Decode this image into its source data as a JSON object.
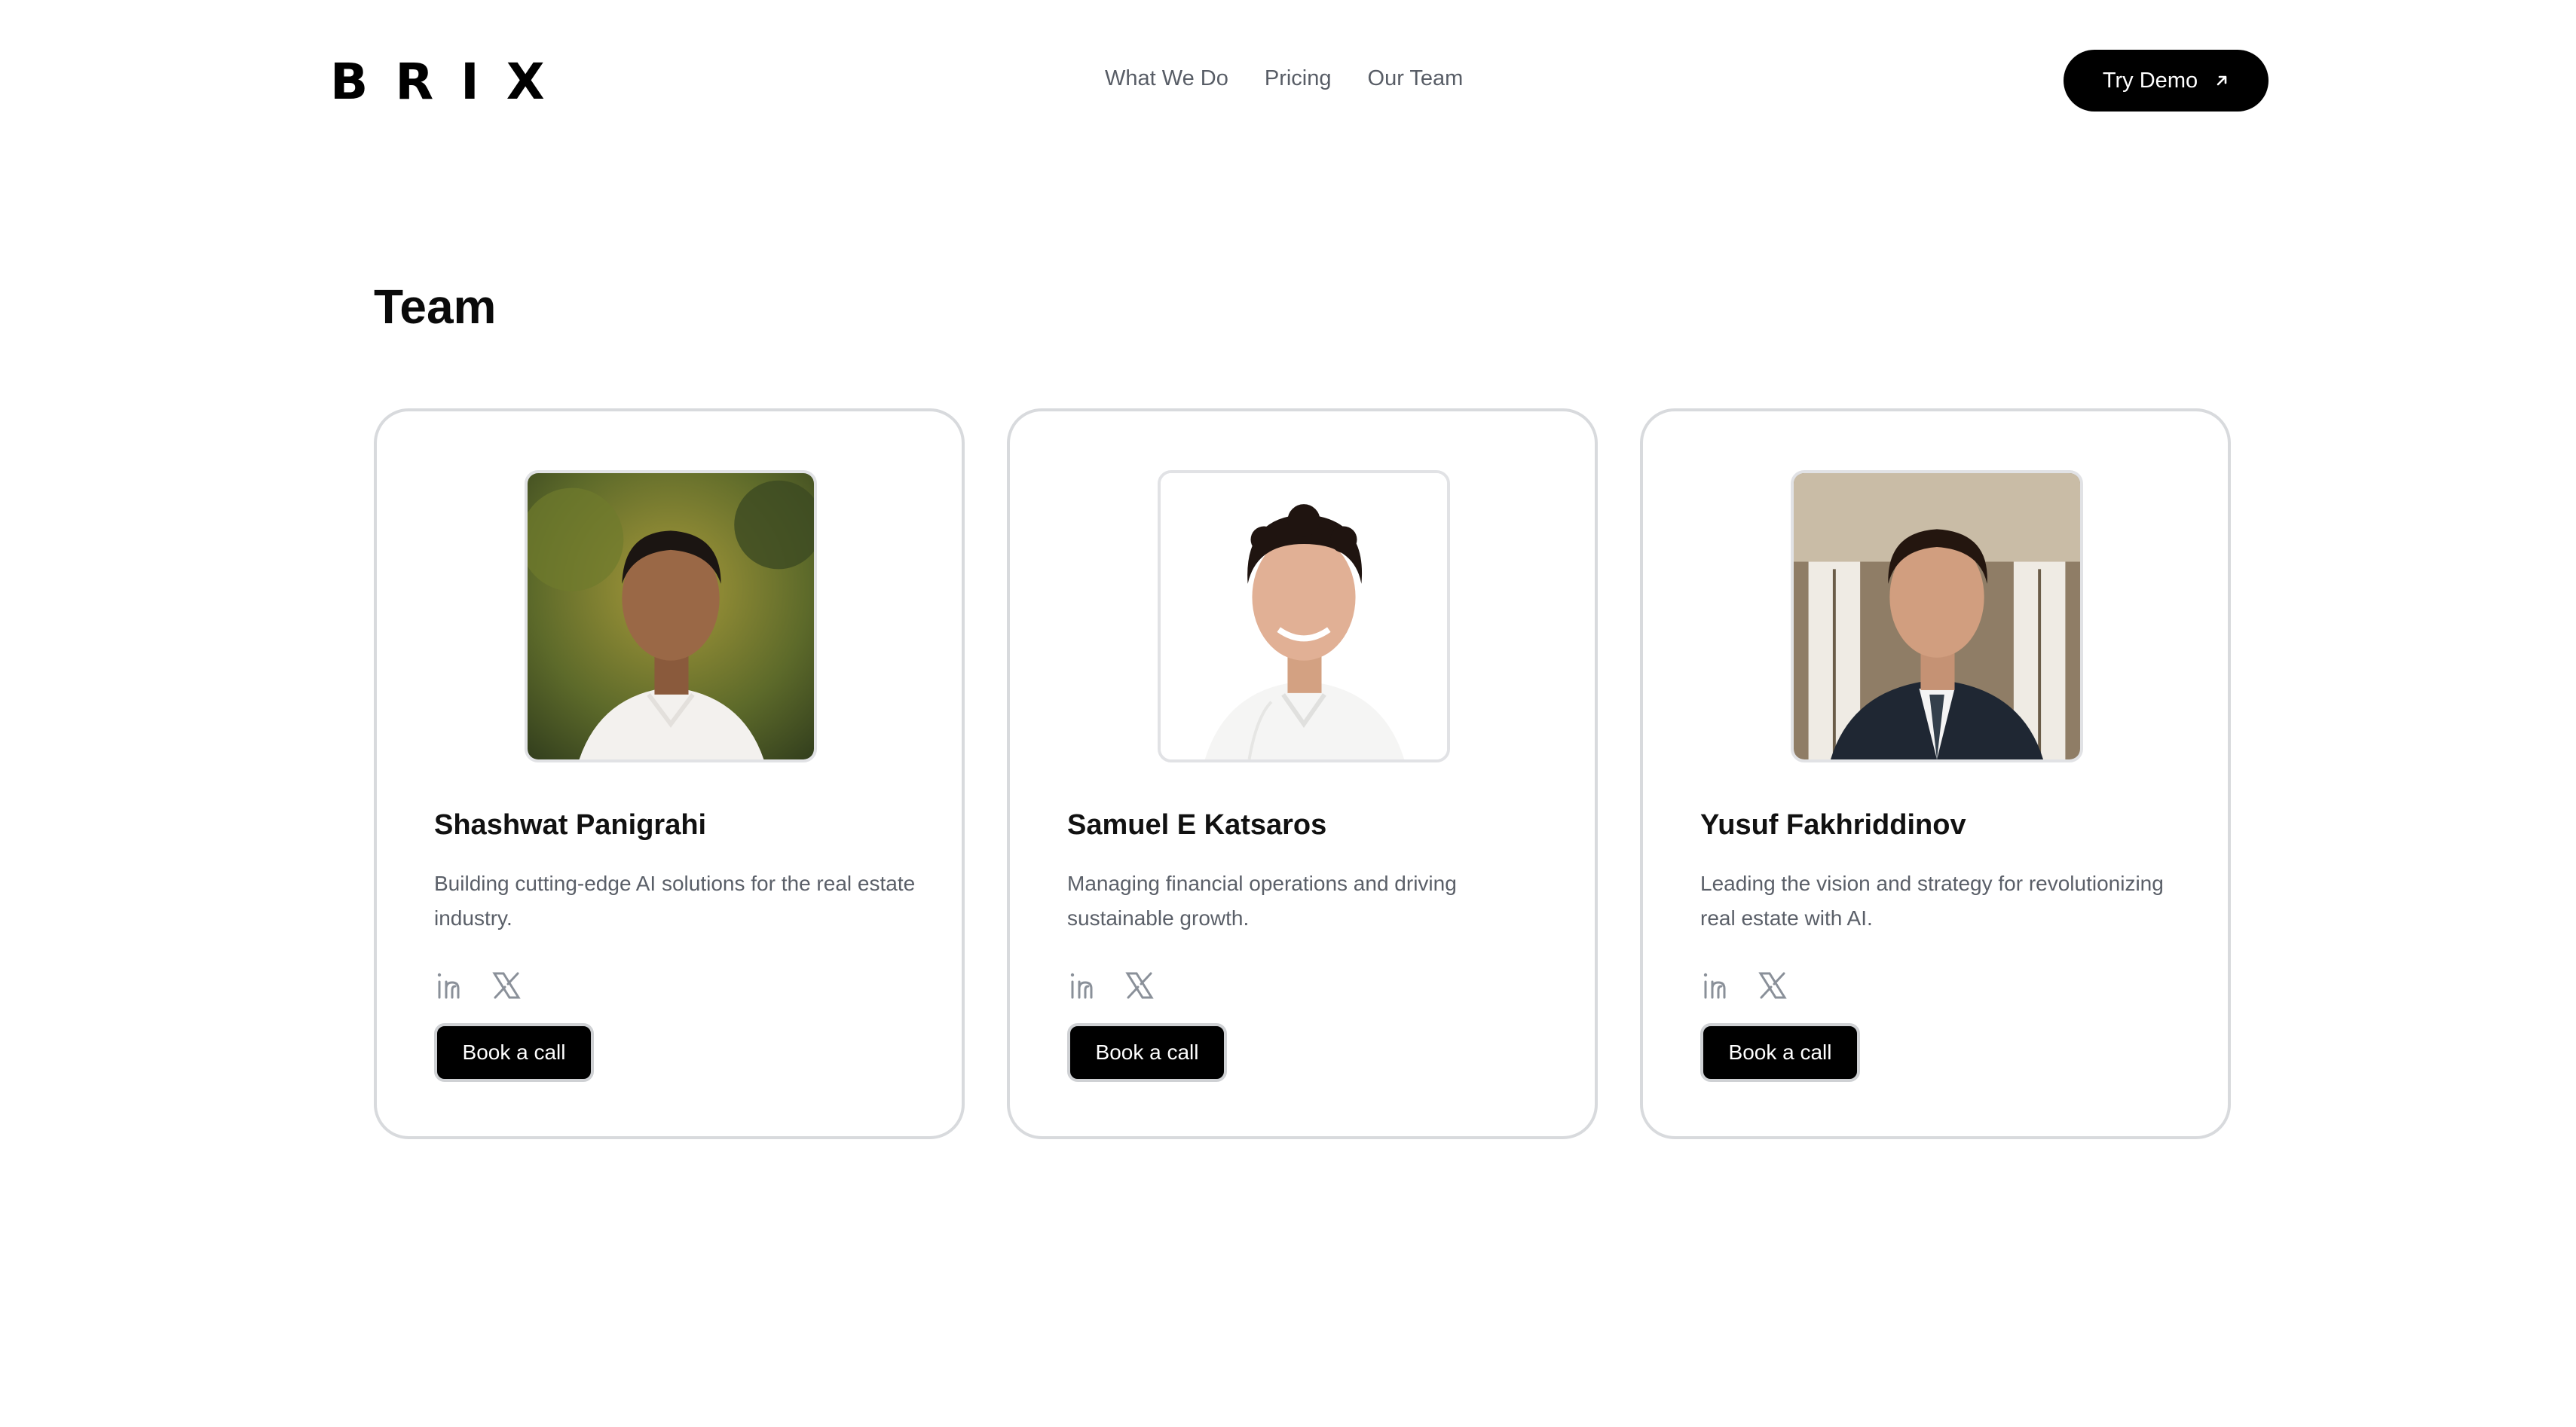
{
  "brand": {
    "logo_letters": [
      "B",
      "R",
      "I",
      "X"
    ]
  },
  "nav": {
    "items": [
      {
        "label": "What We Do"
      },
      {
        "label": "Pricing"
      },
      {
        "label": "Our Team"
      }
    ],
    "cta_label": "Try Demo",
    "cta_icon": "arrow-up-right-icon"
  },
  "team": {
    "title": "Team",
    "members": [
      {
        "name": "Shashwat Panigrahi",
        "bio": "Building cutting-edge AI solutions for the real estate industry.",
        "button_label": "Book a call",
        "socials": [
          "linkedin-icon",
          "x-icon"
        ]
      },
      {
        "name": "Samuel E Katsaros",
        "bio": "Managing financial operations and driving sustainable growth.",
        "button_label": "Book a call",
        "socials": [
          "linkedin-icon",
          "x-icon"
        ]
      },
      {
        "name": "Yusuf Fakhriddinov",
        "bio": "Leading the vision and strategy for revolutionizing real estate with AI.",
        "button_label": "Book a call",
        "socials": [
          "linkedin-icon",
          "x-icon"
        ]
      }
    ]
  },
  "colors": {
    "primary": "#000000",
    "nav_text": "#585d66",
    "body_text": "#5a5f68",
    "card_border": "#d8dadd",
    "icon_gray": "#8a9099"
  }
}
